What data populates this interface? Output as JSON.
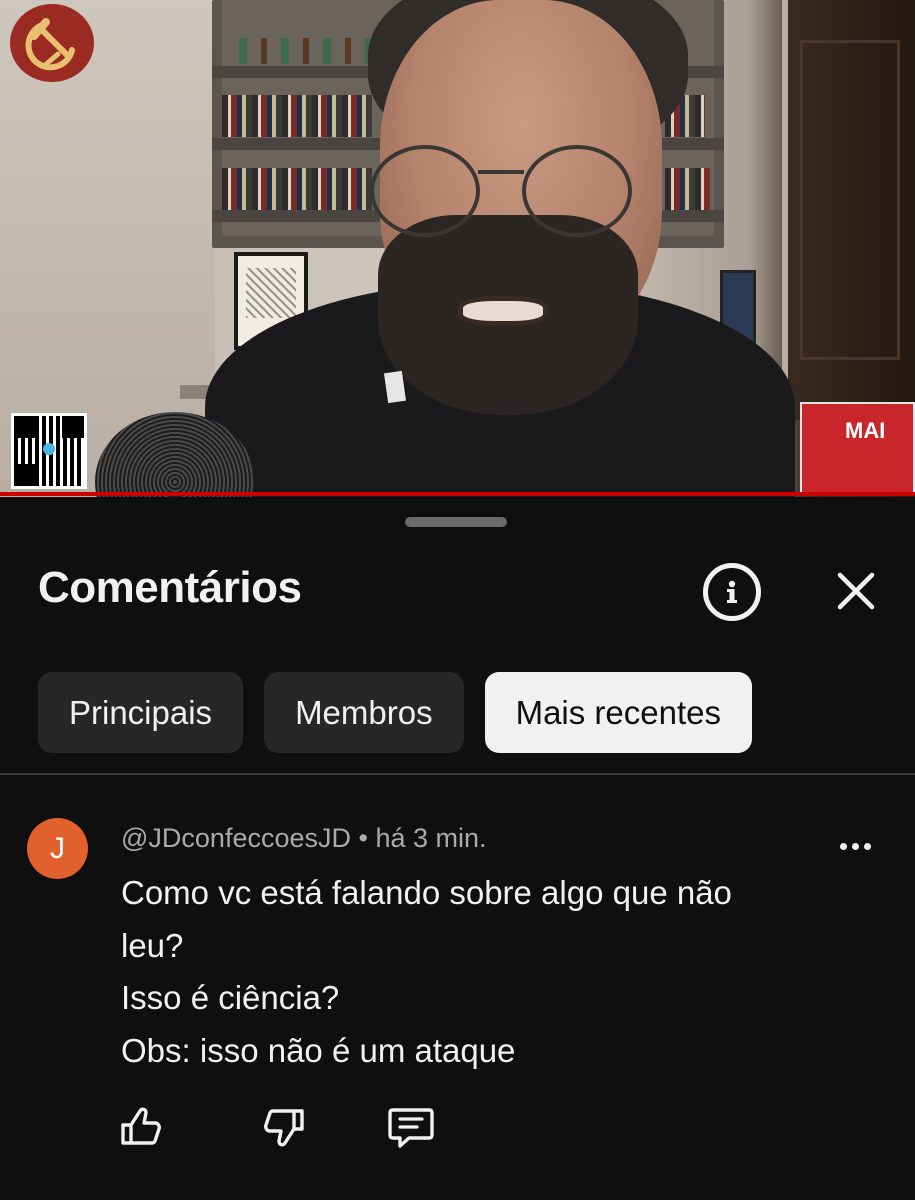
{
  "video": {
    "calendar_text": "MAI",
    "progress_fraction": 1.0
  },
  "comments_panel": {
    "title": "Comentários",
    "icons": {
      "info": "info-icon",
      "close": "close-icon"
    },
    "tabs": [
      {
        "label": "Principais",
        "selected": false
      },
      {
        "label": "Membros",
        "selected": false
      },
      {
        "label": "Mais recentes",
        "selected": true
      }
    ]
  },
  "comment": {
    "avatar_letter": "J",
    "avatar_color": "#e2602c",
    "author": "@JDconfeccoesJD",
    "separator": "•",
    "time": "há 3 min.",
    "text_lines": [
      "Como vc está falando sobre algo que não",
      "leu?",
      "Isso é ciência?",
      "Obs: isso não é um ataque"
    ],
    "actions": [
      "like-icon",
      "dislike-icon",
      "reply-icon"
    ]
  },
  "colors": {
    "background": "#0f0f0f",
    "chip_background": "#272727",
    "chip_selected_background": "#f1f1f1",
    "secondary_text": "#aaaaaa",
    "progress": "#cc0000"
  }
}
